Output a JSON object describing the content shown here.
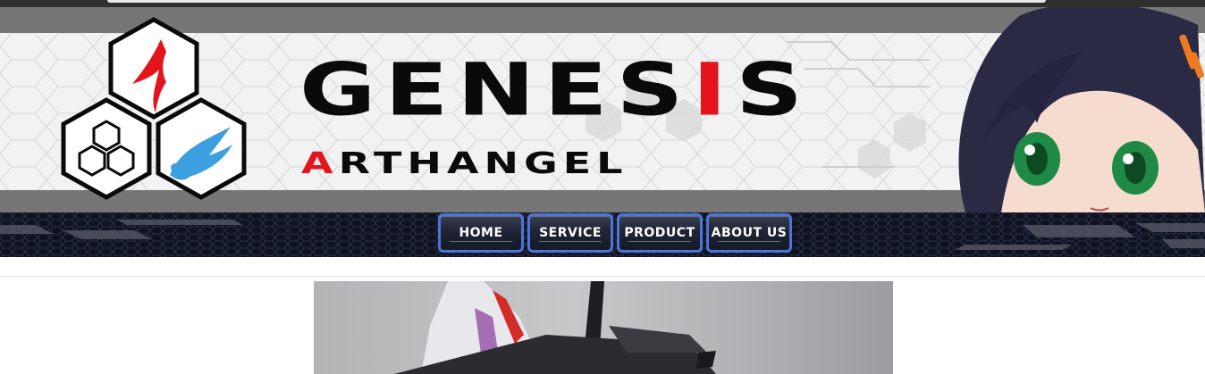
{
  "banner": {
    "title_main_pre": "GENES",
    "title_main_accent": "I",
    "title_main_post": "S",
    "title_sub_accent": "A",
    "title_sub_rest": "RTHANGEL"
  },
  "nav": {
    "items": [
      {
        "label": "Home"
      },
      {
        "label": "Service"
      },
      {
        "label": "Product"
      },
      {
        "label": "About us"
      }
    ]
  },
  "colors": {
    "accent_red": "#e3141b",
    "nav_border": "#4d74d8",
    "banner_stripe": "#767676"
  },
  "icons": [
    "logo-hexagon-icon",
    "red-glyph-icon",
    "triple-hex-icon",
    "blue-wing-icon"
  ]
}
